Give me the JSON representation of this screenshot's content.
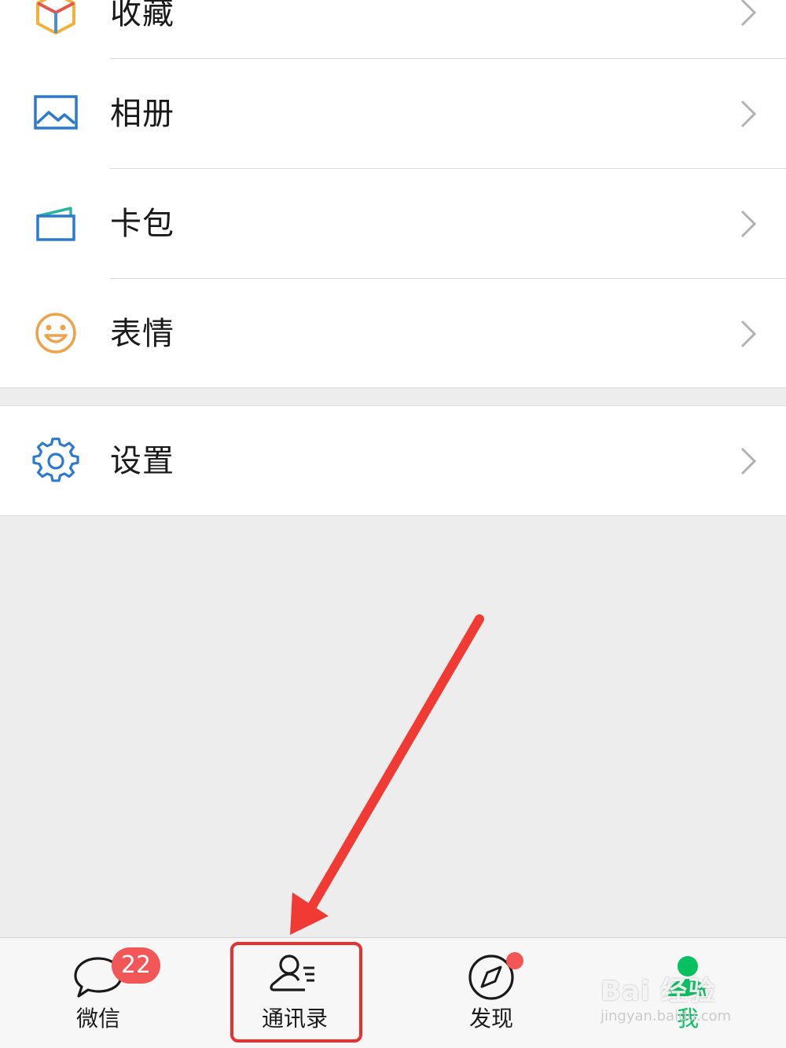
{
  "menu": {
    "items": [
      {
        "id": "favorites",
        "label": "收藏",
        "icon": "cube-icon"
      },
      {
        "id": "album",
        "label": "相册",
        "icon": "image-icon"
      },
      {
        "id": "cards",
        "label": "卡包",
        "icon": "wallet-icon"
      },
      {
        "id": "stickers",
        "label": "表情",
        "icon": "smiley-icon"
      }
    ],
    "settings": {
      "label": "设置",
      "icon": "gear-icon"
    }
  },
  "tabbar": {
    "tabs": [
      {
        "label": "微信",
        "badge": "22",
        "icon": "chat-bubble-icon"
      },
      {
        "label": "通讯录",
        "icon": "contacts-icon"
      },
      {
        "label": "发现",
        "icon": "compass-icon",
        "has_dot": true
      },
      {
        "label": "我",
        "icon": "person-icon",
        "active": true
      }
    ]
  },
  "watermark": {
    "brand": "Bai 经验",
    "url": "jingyan.baidu.com"
  },
  "colors": {
    "accent_green": "#07c160",
    "badge_red": "#f25656",
    "annotation_red": "#e8312f",
    "icon_blue": "#2a7ad0",
    "smiley_orange": "#f0a24a"
  }
}
